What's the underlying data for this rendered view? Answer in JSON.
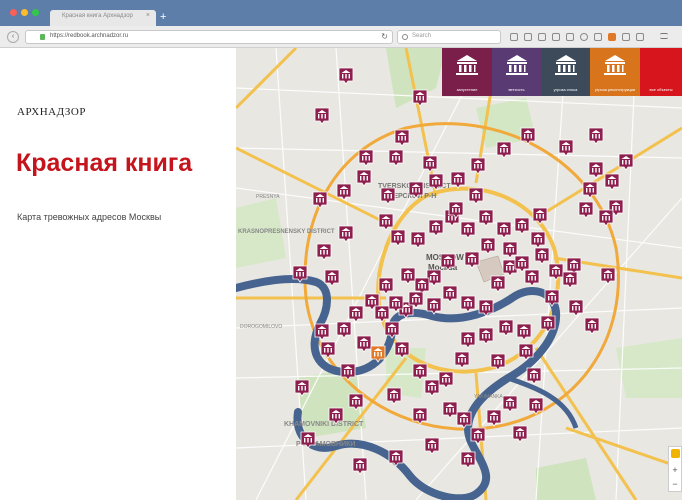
{
  "browser": {
    "tab_title": "Красная книга Архнадзор",
    "tab_close": "×",
    "new_tab": "+",
    "url": "https://redbook.archnadzor.ru",
    "reload": "↻",
    "search_placeholder": "Search"
  },
  "sidebar": {
    "logo": "АРХНАДЗОР",
    "title": "Красная книга",
    "subtitle": "Карта тревожных адресов Москвы"
  },
  "categories": [
    {
      "label": "запустение",
      "color": "#7a1e4a",
      "icon": "building-columns-icon"
    },
    {
      "label": "ветхость",
      "color": "#5a3a73",
      "icon": "building-columns-icon"
    },
    {
      "label": "угроза сноса",
      "color": "#3c4a5a",
      "icon": "crane-icon"
    },
    {
      "label": "угроза реконструкции",
      "color": "#d8741c",
      "icon": "building-columns-icon"
    },
    {
      "label": "все объекты",
      "color": "#d7151c",
      "icon": ""
    }
  ],
  "map_labels": {
    "tverskoy": "TVERSKOY DISTRICT",
    "tverskoy_ru": "ТВЕРСКОЙ Р-Н",
    "krasnopresnensky": "KRASNOPRESNENSKY DISTRICT",
    "moscow": "MOSCOW",
    "moscow_ru": "Москва",
    "khamovniki": "KHAMOVNIKI DISTRICT",
    "khamovniki_ru": "Р-Н ХАМОВНИКИ",
    "dorogomilovo": "DOROGOMILOVO",
    "presnya": "PRESNYA",
    "yakimanka": "YAKIMANKA"
  },
  "zoom": {
    "in": "+",
    "out": "−"
  },
  "colors": {
    "marker": "#8c1f4e",
    "marker_highlight": "#e07a28",
    "river": "#46648f",
    "major_road": "#f2c14e",
    "title_red": "#c4141c"
  },
  "markers": [
    [
      110,
      36
    ],
    [
      86,
      76
    ],
    [
      184,
      58
    ],
    [
      166,
      98
    ],
    [
      130,
      118
    ],
    [
      160,
      118
    ],
    [
      128,
      138
    ],
    [
      108,
      152
    ],
    [
      152,
      156
    ],
    [
      180,
      150
    ],
    [
      200,
      142
    ],
    [
      222,
      140
    ],
    [
      242,
      126
    ],
    [
      268,
      110
    ],
    [
      292,
      96
    ],
    [
      330,
      108
    ],
    [
      360,
      96
    ],
    [
      376,
      142
    ],
    [
      360,
      130
    ],
    [
      390,
      122
    ],
    [
      380,
      168
    ],
    [
      354,
      150
    ],
    [
      84,
      160
    ],
    [
      110,
      194
    ],
    [
      150,
      182
    ],
    [
      162,
      198
    ],
    [
      182,
      200
    ],
    [
      200,
      188
    ],
    [
      216,
      178
    ],
    [
      232,
      190
    ],
    [
      250,
      178
    ],
    [
      268,
      190
    ],
    [
      286,
      186
    ],
    [
      304,
      176
    ],
    [
      302,
      200
    ],
    [
      274,
      210
    ],
    [
      252,
      206
    ],
    [
      236,
      220
    ],
    [
      212,
      222
    ],
    [
      198,
      238
    ],
    [
      186,
      246
    ],
    [
      172,
      236
    ],
    [
      150,
      246
    ],
    [
      136,
      262
    ],
    [
      120,
      274
    ],
    [
      108,
      290
    ],
    [
      86,
      292
    ],
    [
      92,
      310
    ],
    [
      112,
      332
    ],
    [
      128,
      304
    ],
    [
      146,
      274
    ],
    [
      170,
      270
    ],
    [
      180,
      260
    ],
    [
      198,
      266
    ],
    [
      214,
      254
    ],
    [
      232,
      264
    ],
    [
      250,
      268
    ],
    [
      262,
      244
    ],
    [
      274,
      228
    ],
    [
      286,
      224
    ],
    [
      296,
      238
    ],
    [
      306,
      216
    ],
    [
      320,
      232
    ],
    [
      338,
      226
    ],
    [
      316,
      258
    ],
    [
      312,
      284
    ],
    [
      288,
      292
    ],
    [
      270,
      288
    ],
    [
      250,
      296
    ],
    [
      232,
      300
    ],
    [
      226,
      320
    ],
    [
      210,
      340
    ],
    [
      196,
      348
    ],
    [
      184,
      332
    ],
    [
      166,
      310
    ],
    [
      156,
      290
    ],
    [
      142,
      314
    ],
    [
      66,
      348
    ],
    [
      72,
      400
    ],
    [
      100,
      376
    ],
    [
      120,
      362
    ],
    [
      158,
      356
    ],
    [
      184,
      376
    ],
    [
      214,
      370
    ],
    [
      228,
      380
    ],
    [
      242,
      396
    ],
    [
      258,
      378
    ],
    [
      274,
      364
    ],
    [
      298,
      336
    ],
    [
      300,
      366
    ],
    [
      284,
      394
    ],
    [
      232,
      420
    ],
    [
      160,
      418
    ],
    [
      124,
      426
    ],
    [
      88,
      212
    ],
    [
      64,
      234
    ],
    [
      96,
      238
    ],
    [
      340,
      268
    ],
    [
      356,
      286
    ],
    [
      334,
      240
    ],
    [
      372,
      236
    ],
    [
      220,
      170
    ],
    [
      240,
      156
    ],
    [
      194,
      124
    ],
    [
      160,
      264
    ],
    [
      262,
      322
    ],
    [
      196,
      406
    ],
    [
      290,
      312
    ],
    [
      370,
      178
    ],
    [
      350,
      170
    ]
  ]
}
